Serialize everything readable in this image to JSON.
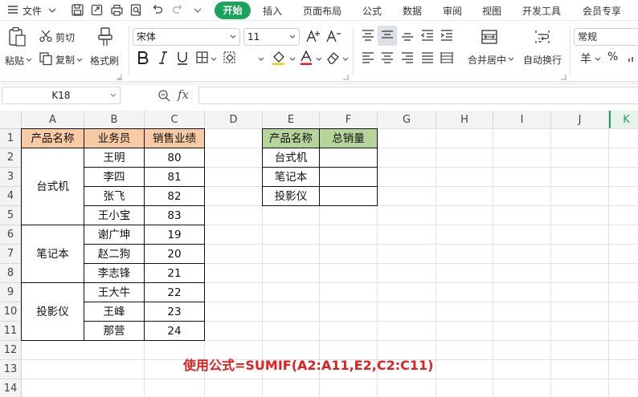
{
  "menubar": {
    "file_label": "文件",
    "tabs": [
      "开始",
      "插入",
      "页面布局",
      "公式",
      "数据",
      "审阅",
      "视图",
      "开发工具",
      "会员专享"
    ]
  },
  "ribbon": {
    "paste": "粘贴",
    "cut": "剪切",
    "copy": "复制",
    "format_painter": "格式刷",
    "font_name": "宋体",
    "font_size": "11",
    "merge_center": "合并居中",
    "wrap_text": "自动换行",
    "number_format": "常规",
    "currency_symbol": "羊",
    "percent_symbol": "%"
  },
  "formula_bar": {
    "name_box": "K18",
    "fx_label": "fx",
    "content": ""
  },
  "columns": [
    "A",
    "B",
    "C",
    "D",
    "E",
    "F",
    "G",
    "H",
    "I",
    "J",
    "K"
  ],
  "rows": [
    "1",
    "2",
    "3",
    "4",
    "5",
    "6",
    "7",
    "8",
    "9",
    "10",
    "11",
    "12",
    "13",
    "14"
  ],
  "table1": {
    "headers": [
      "产品名称",
      "业务员",
      "销售业绩"
    ],
    "groups": [
      {
        "product": "台式机",
        "rows": [
          [
            "王明",
            "80"
          ],
          [
            "李四",
            "81"
          ],
          [
            "张飞",
            "82"
          ],
          [
            "王小宝",
            "83"
          ]
        ]
      },
      {
        "product": "笔记本",
        "rows": [
          [
            "谢广坤",
            "19"
          ],
          [
            "赵二狗",
            "20"
          ],
          [
            "李志锋",
            "21"
          ]
        ]
      },
      {
        "product": "投影仪",
        "rows": [
          [
            "王大牛",
            "22"
          ],
          [
            "王峰",
            "23"
          ],
          [
            "那营",
            "24"
          ]
        ]
      }
    ]
  },
  "table2": {
    "headers": [
      "产品名称",
      "总销量"
    ],
    "products": [
      "台式机",
      "笔记本",
      "投影仪"
    ]
  },
  "note": "使用公式=SUMIF(A2:A11,E2,C2:C11)",
  "colors": {
    "accent_green": "#1aa35a",
    "header_orange": "#f8cba5",
    "header_green": "#b7d59a",
    "note_red": "#e02020"
  }
}
